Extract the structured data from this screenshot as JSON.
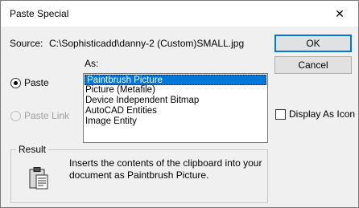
{
  "window": {
    "title": "Paste Special",
    "close_glyph": "✕"
  },
  "source": {
    "label": "Source:",
    "value": "C:\\Sophisticadd\\danny-2 (Custom)SMALL.jpg"
  },
  "buttons": {
    "ok_label": "OK",
    "cancel_label": "Cancel"
  },
  "as_label": "As:",
  "options": {
    "paste_label": "Paste",
    "paste_link_label": "Paste Link",
    "selected": "paste"
  },
  "formats": [
    {
      "label": "Paintbrush Picture",
      "selected": true
    },
    {
      "label": "Picture (Metafile)",
      "selected": false
    },
    {
      "label": "Device Independent Bitmap",
      "selected": false
    },
    {
      "label": "AutoCAD Entities",
      "selected": false
    },
    {
      "label": "Image Entity",
      "selected": false
    }
  ],
  "display_as_icon": {
    "label": "Display As Icon",
    "checked": false
  },
  "result": {
    "legend": "Result",
    "icon": "clipboard-icon",
    "text": "Inserts the contents of the clipboard into your document as Paintbrush Picture."
  },
  "colors": {
    "accent": "#0078d7",
    "dialog_bg": "#f0f0f0"
  }
}
